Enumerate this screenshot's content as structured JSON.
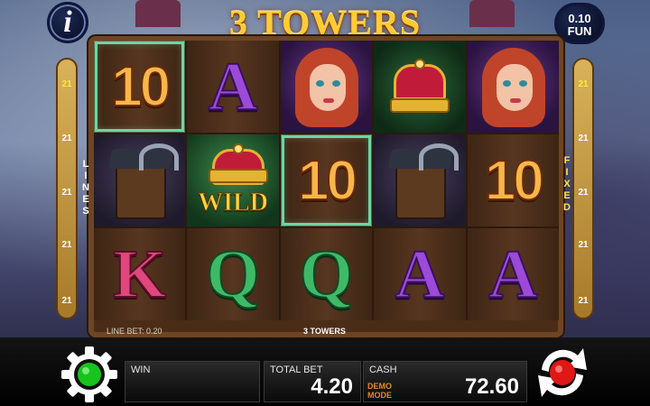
{
  "header": {
    "title": "3 TOWERS",
    "info_icon": "info-icon",
    "denomination": "0.10",
    "currency": "FUN"
  },
  "reels": {
    "rows": [
      [
        {
          "symbol": "10",
          "kind": "ten",
          "highlight": true
        },
        {
          "symbol": "A",
          "kind": "ace",
          "highlight": false
        },
        {
          "symbol": "girl",
          "kind": "girl",
          "highlight": false
        },
        {
          "symbol": "crown",
          "kind": "crown",
          "highlight": false
        },
        {
          "symbol": "girl",
          "kind": "girl",
          "highlight": false
        }
      ],
      [
        {
          "symbol": "tower",
          "kind": "tower",
          "highlight": true
        },
        {
          "symbol": "WILD",
          "kind": "wild",
          "highlight": true
        },
        {
          "symbol": "10",
          "kind": "ten",
          "highlight": true
        },
        {
          "symbol": "tower",
          "kind": "tower",
          "highlight": false
        },
        {
          "symbol": "10",
          "kind": "ten",
          "highlight": false
        }
      ],
      [
        {
          "symbol": "K",
          "kind": "king",
          "highlight": false
        },
        {
          "symbol": "Q",
          "kind": "queen",
          "highlight": false
        },
        {
          "symbol": "Q",
          "kind": "queen",
          "highlight": false
        },
        {
          "symbol": "A",
          "kind": "ace",
          "highlight": false
        },
        {
          "symbol": "A",
          "kind": "ace",
          "highlight": false
        }
      ]
    ]
  },
  "lines": {
    "left_numbers": [
      "21",
      "21",
      "21",
      "21",
      "21"
    ],
    "right_numbers": [
      "21",
      "21",
      "21",
      "21",
      "21"
    ],
    "left_word": "LINES",
    "right_word": "FIXED"
  },
  "info_strip": {
    "line_bet": "LINE BET: 0.20",
    "game_name": "3 TOWERS"
  },
  "bottom_bar": {
    "win_label": "WIN",
    "win_value": "",
    "total_bet_label": "TOTAL BET",
    "total_bet_value": "4.20",
    "cash_label": "CASH",
    "cash_value": "72.60",
    "demo_mode_line1": "DEMO",
    "demo_mode_line2": "MODE",
    "settings_icon": "gear-icon",
    "spin_icon": "spin-icon"
  },
  "colors": {
    "highlight": "#69d7a5",
    "accent_gold": "#ffcc33",
    "spin_red": "#e11717",
    "settings_green": "#18c31c"
  }
}
